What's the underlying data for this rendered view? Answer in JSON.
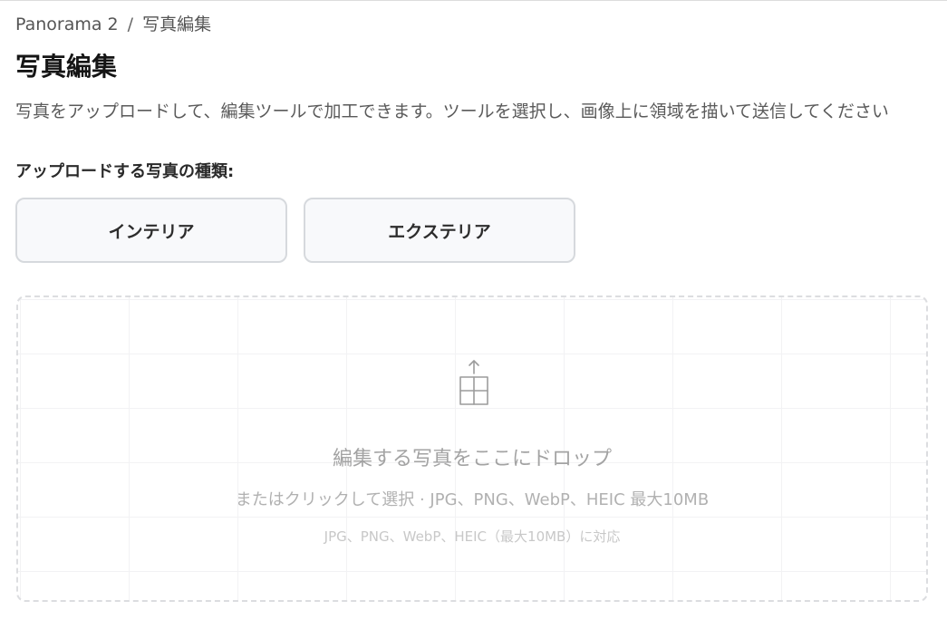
{
  "breadcrumb": {
    "root": "Panorama 2",
    "separator": "/",
    "current": "写真編集"
  },
  "page": {
    "title": "写真編集",
    "description": "写真をアップロードして、編集ツールで加工できます。ツールを選択し、画像上に領域を描いて送信してください"
  },
  "photo_type": {
    "label": "アップロードする写真の種類:",
    "options": [
      {
        "label": "インテリア"
      },
      {
        "label": "エクステリア"
      }
    ]
  },
  "dropzone": {
    "icon": "upload-icon",
    "title": "編集する写真をここにドロップ",
    "subtitle": "またはクリックして選択 · JPG、PNG、WebP、HEIC 最大10MB",
    "note": "JPG、PNG、WebP、HEIC（最大10MB）に対応"
  },
  "colors": {
    "button_border": "#d6d9dd",
    "button_bg": "#f8f9fb",
    "dropzone_border": "#dcdde0",
    "muted_text": "#a3a3a3"
  }
}
